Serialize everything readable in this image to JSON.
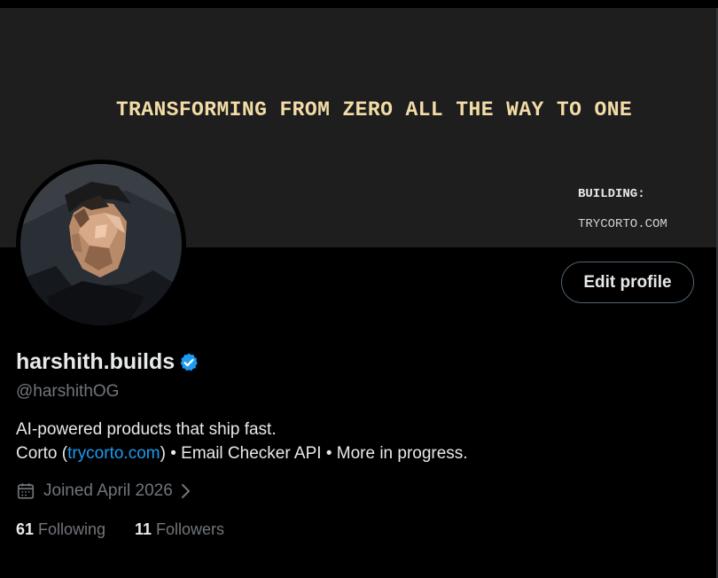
{
  "banner": {
    "headline": "TRANSFORMING FROM ZERO ALL THE WAY TO ONE",
    "building_label": "BUILDING:",
    "building_site": "TRYCORTO.COM"
  },
  "profile": {
    "display_name": "harshith.builds",
    "handle": "@harshithOG",
    "verified": true,
    "bio_line1": "AI-powered products that ship fast.",
    "bio_line2_prefix": "Corto (",
    "bio_link": "trycorto.com",
    "bio_line2_suffix": ") • Email Checker API • More in progress.",
    "joined": "Joined April 2026",
    "following_count": "61",
    "following_label": "Following",
    "followers_count": "11",
    "followers_label": "Followers"
  },
  "actions": {
    "edit_profile_label": "Edit profile"
  },
  "colors": {
    "accent": "#1d9bf0",
    "banner_text": "#f3dca6",
    "muted_text": "#71767b",
    "primary_text": "#e7e9ea"
  },
  "icons": {
    "verified": "verified-badge-icon",
    "joined": "calendar-icon",
    "chevron": "chevron-right-icon"
  }
}
